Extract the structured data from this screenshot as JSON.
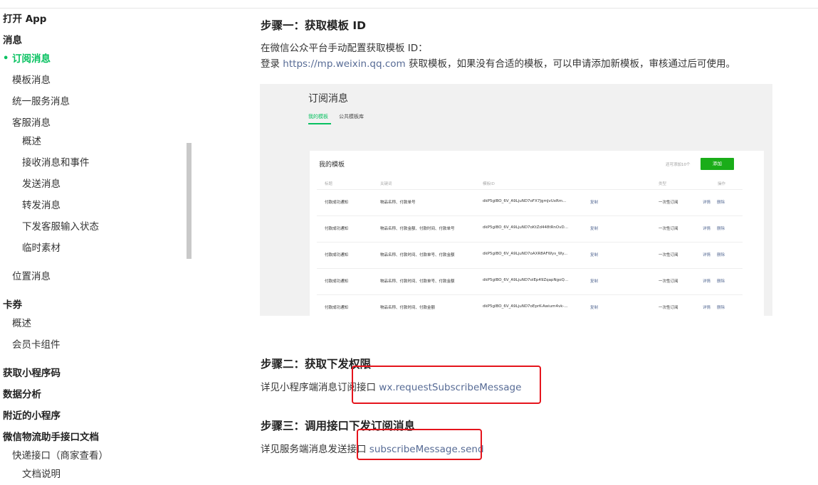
{
  "sidebar": {
    "items": [
      {
        "label": "打开 App",
        "bold": true
      },
      {
        "label": "消息",
        "bold": true
      },
      {
        "label": "订阅消息",
        "active": true
      },
      {
        "label": "模板消息"
      },
      {
        "label": "统一服务消息"
      },
      {
        "label": "客服消息"
      },
      {
        "label": "概述"
      },
      {
        "label": "接收消息和事件"
      },
      {
        "label": "发送消息"
      },
      {
        "label": "转发消息"
      },
      {
        "label": "下发客服输入状态"
      },
      {
        "label": "临时素材"
      },
      {
        "label": "位置消息"
      },
      {
        "label": "卡券",
        "bold": true
      },
      {
        "label": "概述"
      },
      {
        "label": "会员卡组件"
      },
      {
        "label": "获取小程序码",
        "bold": true
      },
      {
        "label": "数据分析",
        "bold": true
      },
      {
        "label": "附近的小程序",
        "bold": true
      },
      {
        "label": "微信物流助手接口文档",
        "bold": true
      },
      {
        "label": "快递接口（商家查看）"
      },
      {
        "label": "文档说明"
      }
    ]
  },
  "step1": {
    "title": "步骤一：获取模板 ID",
    "line1": "在微信公众平台手动配置获取模板 ID：",
    "line2_prefix": "登录 ",
    "line2_link": "https://mp.weixin.qq.com",
    "line2_suffix": " 获取模板，如果没有合适的模板，可以申请添加新模板，审核通过后可使用。"
  },
  "screenshot": {
    "title": "订阅消息",
    "tab_active": "我的模板",
    "tab_other": "公共模板库",
    "card_title": "我的模板",
    "card_hint": "还可添加10个",
    "add_button": "添加",
    "headers": [
      "标题",
      "关键词",
      "模板ID",
      "类型",
      "操作"
    ],
    "rows": [
      {
        "title": "付款成功通知",
        "keywords": "物品名称、付款单号",
        "id": "dkP5gIBO_6V_A9LjuND7oFX7JgmJvUxRm...",
        "copy": "复制",
        "type": "一次性订阅",
        "detail": "详情",
        "delete": "删除"
      },
      {
        "title": "付款成功通知",
        "keywords": "物品名称、付款金额、付款时间、付款单号",
        "id": "dkP5gIBO_6V_A9LjuND7oKtZd448tRnOvD...",
        "copy": "复制",
        "type": "一次性订阅",
        "detail": "详情",
        "delete": "删除"
      },
      {
        "title": "付款成功通知",
        "keywords": "物品名称、付款时间、付款单号、付款金额",
        "id": "dkP5gIBO_6V_A9LjuND7oAXR8AFWys_Wy...",
        "copy": "复制",
        "type": "一次性订阅",
        "detail": "详情",
        "delete": "删除"
      },
      {
        "title": "付款成功通知",
        "keywords": "物品名称、付款时间、付款单号、付款金额",
        "id": "dkP5gIBO_6V_A9LjuND7olEp49ZqapNgoQ...",
        "copy": "复制",
        "type": "一次性订阅",
        "detail": "详情",
        "delete": "删除"
      },
      {
        "title": "付款成功通知",
        "keywords": "物品名称、付款时间、付款金额",
        "id": "dkP5gIBO_6V_A9LjuND7oEprK-Awium4vk-...",
        "copy": "复制",
        "type": "一次性订阅",
        "detail": "详情",
        "delete": "删除"
      }
    ]
  },
  "step2": {
    "title": "步骤二：获取下发权限",
    "text": "详见小程序端消息订阅接口 ",
    "link": "wx.requestSubscribeMessage"
  },
  "step3": {
    "title": "步骤三：调用接口下发订阅消息",
    "text": "详见服务端消息发送接口 ",
    "link": "subscribeMessage.send"
  },
  "colors": {
    "accent": "#07c160",
    "link": "#576b95",
    "highlight_box": "#e5141c"
  }
}
